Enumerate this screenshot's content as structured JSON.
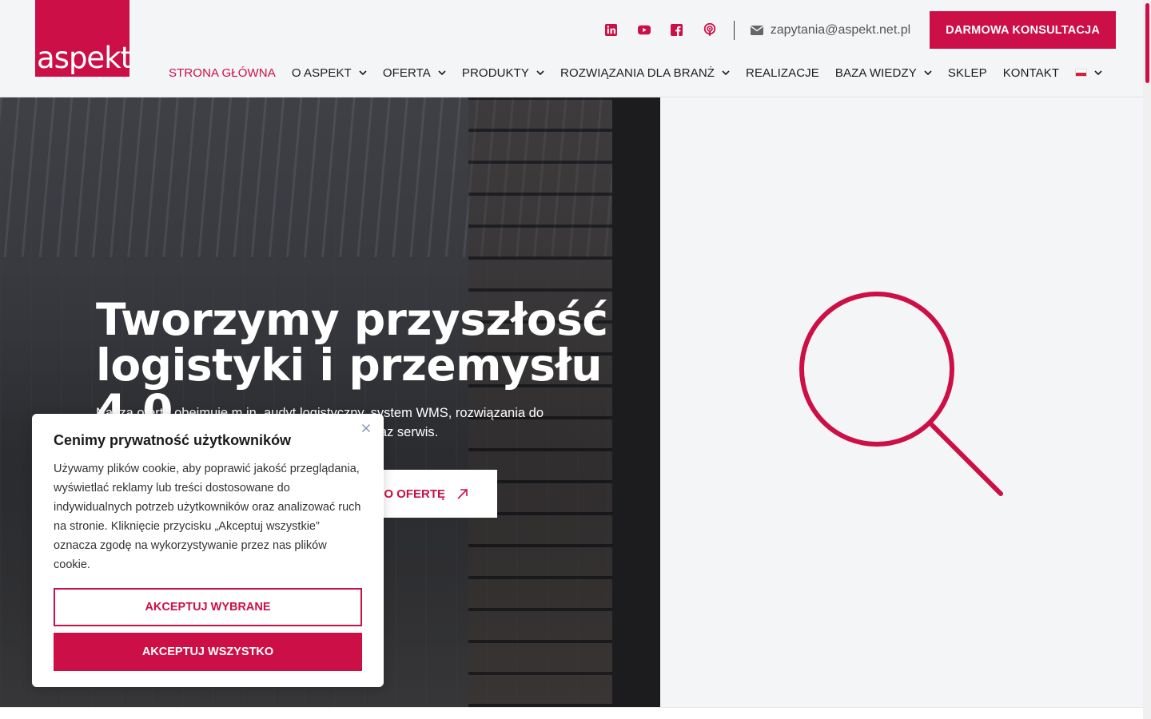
{
  "brand": {
    "logo_text": "aspekt",
    "accent": "#cc0f46"
  },
  "topbar": {
    "social": [
      {
        "icon": "linkedin-icon"
      },
      {
        "icon": "youtube-icon"
      },
      {
        "icon": "facebook-icon"
      },
      {
        "icon": "podcast-icon"
      }
    ],
    "email": "zapytania@aspekt.net.pl",
    "cta_label": "DARMOWA KONSULTACJA"
  },
  "nav": {
    "items": [
      {
        "label": "STRONA GŁÓWNA",
        "active": true,
        "dropdown": false
      },
      {
        "label": "O ASPEKT",
        "dropdown": true
      },
      {
        "label": "OFERTA",
        "dropdown": true
      },
      {
        "label": "PRODUKTY",
        "dropdown": true
      },
      {
        "label": "ROZWIĄZANIA DLA BRANŻ",
        "dropdown": true
      },
      {
        "label": "REALIZACJE",
        "dropdown": false
      },
      {
        "label": "BAZA WIEDZY",
        "dropdown": true
      },
      {
        "label": "SKLEP",
        "dropdown": false
      },
      {
        "label": "KONTAKT",
        "dropdown": false
      }
    ],
    "language": "pl"
  },
  "hero": {
    "title": "Tworzymy przyszłość logistyki i przemysłu 4.0",
    "description": "Nasza oferta obejmuje m.in. audyt logistyczny, system WMS, rozwiązania do automatyzacji i optymalizacji magazynów i hal oraz serwis.",
    "button_label": "O OFERTĘ"
  },
  "cookie": {
    "title": "Cenimy prywatność użytkowników",
    "text": "Używamy plików cookie, aby poprawić jakość przeglądania, wyświetlać reklamy lub treści dostosowane do indywidualnych potrzeb użytkowników oraz analizować ruch na stronie. Kliknięcie przycisku „Akceptuj wszystkie” oznacza zgodę na wykorzystywanie przez nas plików cookie.",
    "btn_selected": "AKCEPTUJ WYBRANE",
    "btn_all": "AKCEPTUJ WSZYSTKO"
  }
}
